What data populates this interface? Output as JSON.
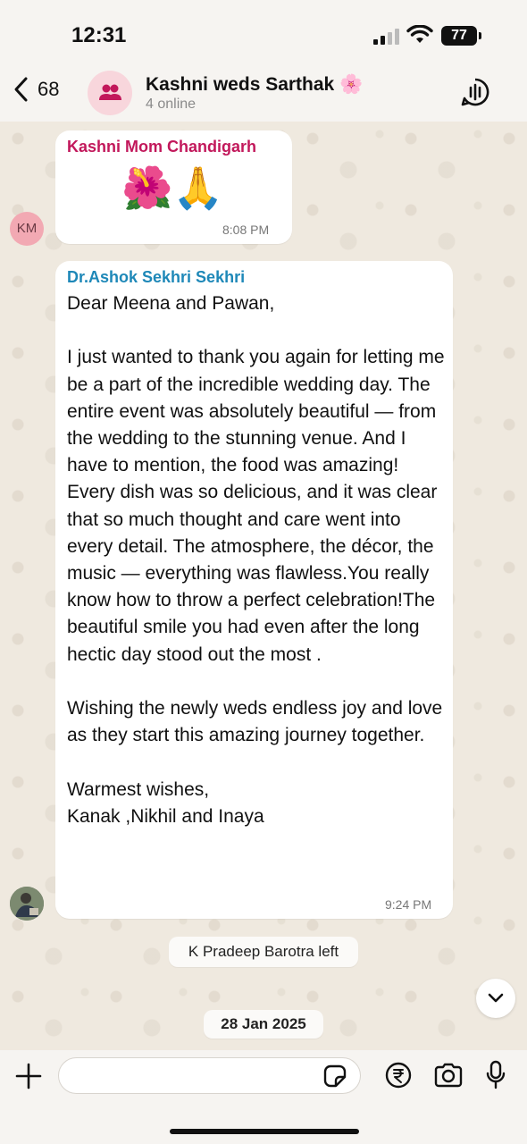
{
  "status": {
    "time": "12:31",
    "battery": "77"
  },
  "header": {
    "back_count": "68",
    "group_name": "Kashni weds Sarthak 🌸",
    "online": "4 online"
  },
  "messages": [
    {
      "sender": "Kashni Mom Chandigarh",
      "sender_color": "#c2185b",
      "text": "🌺🙏",
      "time": "8:08 PM",
      "avatar": "KM"
    },
    {
      "sender": "Dr.Ashok Sekhri Sekhri",
      "sender_color": "#1e88b8",
      "text": "Dear Meena and Pawan,\n\nI just wanted to thank you again for letting me be a part of the incredible wedding day. The entire event was absolutely beautiful — from the wedding to the stunning venue. And I have to mention, the food was amazing! Every dish was so delicious, and it was clear that so much thought and care went into every detail. The atmosphere, the décor, the music — everything was flawless.You really know how to throw a perfect celebration!The beautiful smile you had even after the long hectic day stood out the most .\n\nWishing the newly weds endless joy and love as they start this amazing journey together.\n\nWarmest wishes,\nKanak ,Nikhil and Inaya",
      "time": "9:24 PM"
    }
  ],
  "system_notice": "K Pradeep Barotra left",
  "date_pill": "28 Jan 2025",
  "composer": {
    "placeholder": ""
  },
  "icons": [
    "back-chevron-icon",
    "group-icon",
    "call-icon",
    "chevron-down-icon",
    "plus-icon",
    "sticker-icon",
    "rupee-icon",
    "camera-icon",
    "mic-icon"
  ]
}
